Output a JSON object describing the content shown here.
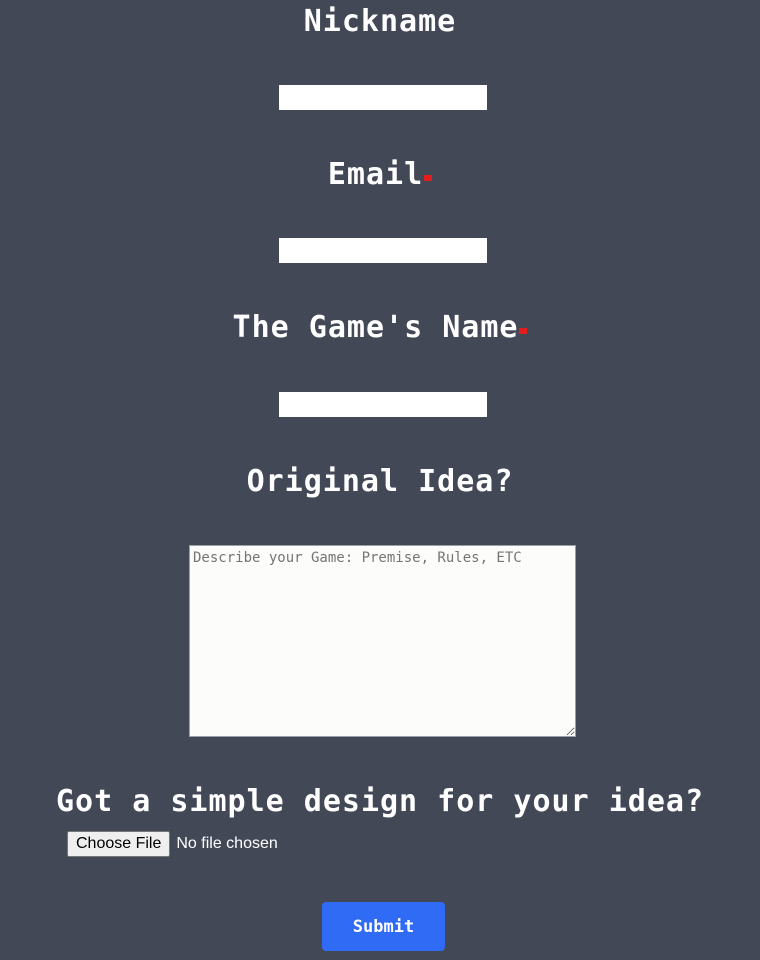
{
  "form": {
    "nickname": {
      "label": "Nickname",
      "value": ""
    },
    "email": {
      "label": "Email",
      "required": true,
      "value": ""
    },
    "game_name": {
      "label": "The Game's Name",
      "required": true,
      "value": ""
    },
    "idea": {
      "label": "Original Idea?",
      "placeholder": "Describe your Game: Premise, Rules, ETC",
      "value": ""
    },
    "design": {
      "label": "Got a simple design for your idea?",
      "choose_label": "Choose File",
      "status": "No file chosen"
    },
    "submit_label": "Submit"
  },
  "colors": {
    "background": "#434857",
    "label_text": "#ffffff",
    "required_marker": "#e11d1d",
    "submit_button": "#2f6bf4"
  }
}
